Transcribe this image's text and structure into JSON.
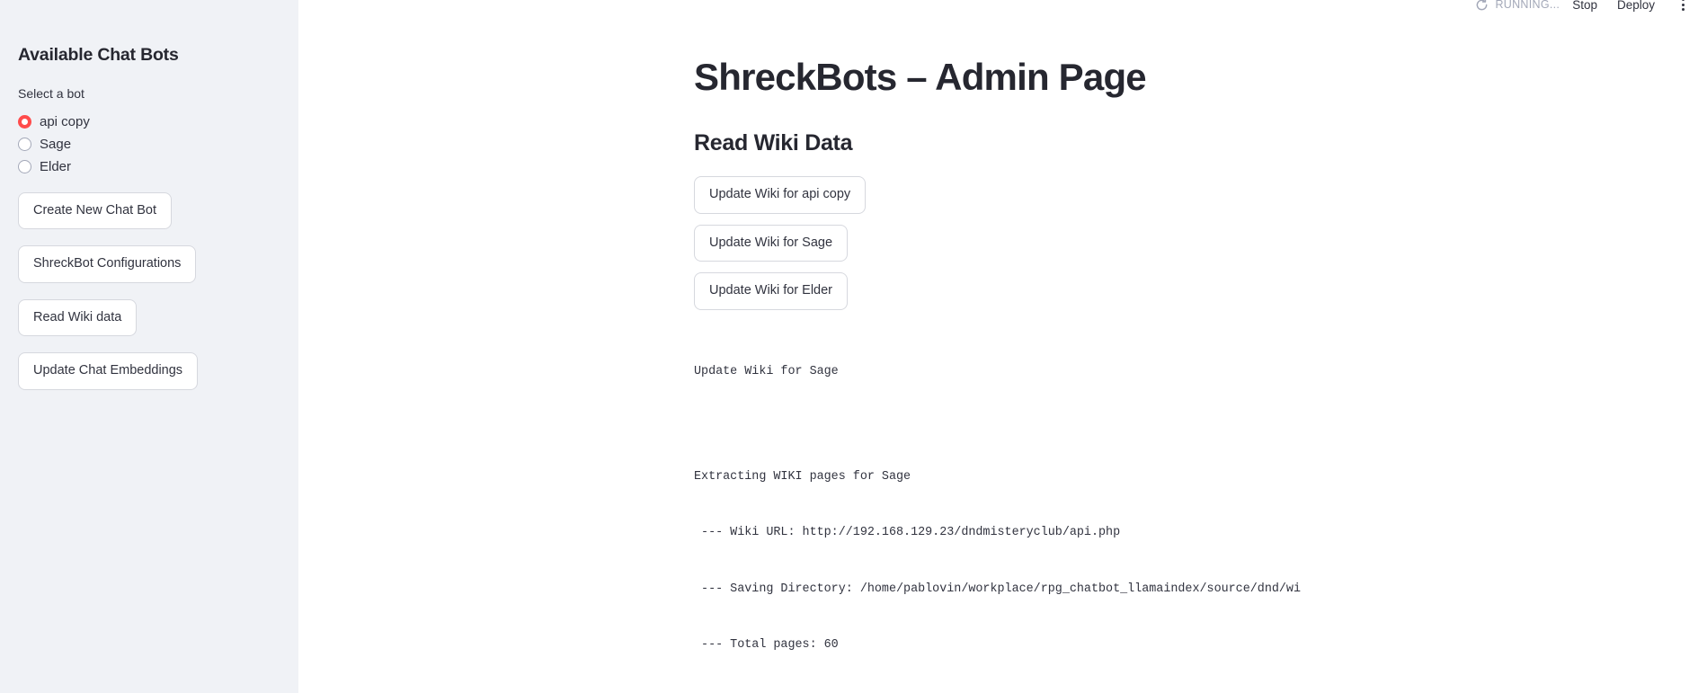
{
  "toolbar": {
    "status_text": "RUNNING...",
    "status_icon": "running-spinner-icon",
    "stop_label": "Stop",
    "deploy_label": "Deploy",
    "menu_icon": "kebab-menu-icon"
  },
  "sidebar": {
    "title": "Available Chat Bots",
    "radio_group": {
      "label": "Select a bot",
      "selected": "api copy",
      "options": [
        {
          "label": "api copy",
          "selected": true
        },
        {
          "label": "Sage",
          "selected": false
        },
        {
          "label": "Elder",
          "selected": false
        }
      ]
    },
    "buttons": [
      {
        "label": "Create New Chat Bot"
      },
      {
        "label": "ShreckBot Configurations"
      },
      {
        "label": "Read Wiki data"
      },
      {
        "label": "Update Chat Embeddings"
      }
    ]
  },
  "main": {
    "page_title": "ShreckBots – Admin Page",
    "section_title": "Read Wiki Data",
    "buttons": [
      {
        "label": "Update Wiki for api copy"
      },
      {
        "label": "Update Wiki for Sage"
      },
      {
        "label": "Update Wiki for Elder"
      }
    ],
    "output": {
      "caption": "Update Wiki for Sage",
      "lines": [
        "Extracting WIKI pages for Sage",
        " --- Wiki URL: http://192.168.129.23/dndmisteryclub/api.php",
        " --- Saving Directory: /home/pablovin/workplace/rpg_chatbot_llamaindex/source/dnd/wi",
        " --- Total pages: 60"
      ]
    }
  },
  "colors": {
    "accent": "#ff4b4b",
    "sidebar_bg": "#f0f2f6",
    "main_bg": "#ffffff",
    "text": "#31333f",
    "heading": "#262730",
    "border": "#d6d8de",
    "muted": "#a3a8b8"
  }
}
